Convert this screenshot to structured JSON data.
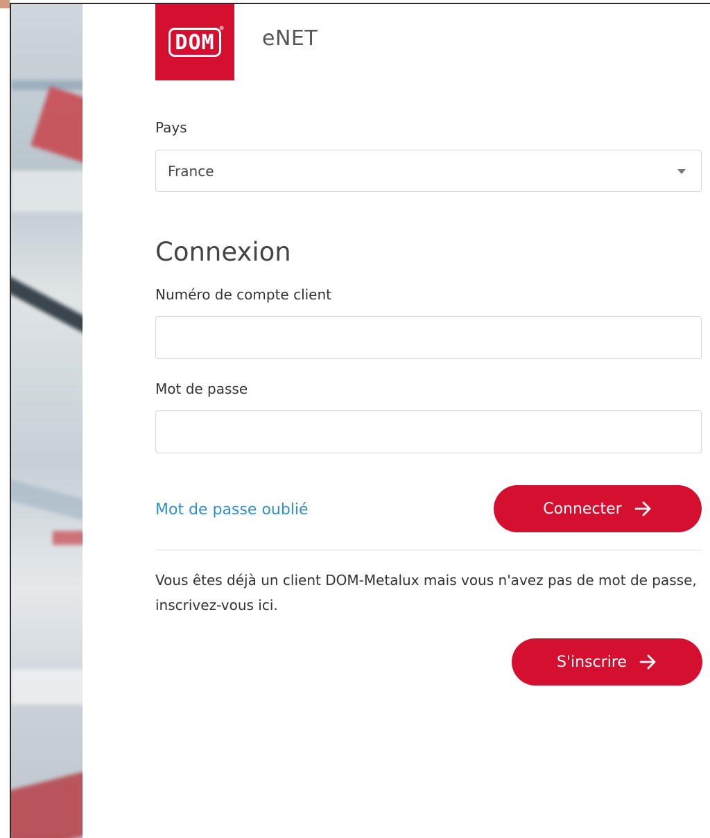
{
  "brand": {
    "logo_text": "DOM",
    "logo_reg": "®",
    "app_name": "eNET",
    "accent_color": "#d50f2f",
    "link_color": "#2f8fcd"
  },
  "country": {
    "label": "Pays",
    "selected": "France"
  },
  "login": {
    "title": "Connexion",
    "account_label": "Numéro de compte client",
    "account_value": "",
    "password_label": "Mot de passe",
    "password_value": "",
    "forgot_link": "Mot de passe oublié",
    "connect_label": "Connecter"
  },
  "register": {
    "info": "Vous êtes déjà un client DOM-Metalux mais vous n'avez pas de mot de passe, inscrivez-vous ici.",
    "button_label": "S'inscrire"
  },
  "icons": {
    "arrow": "arrow-right-icon",
    "dropdown": "caret-down-icon"
  }
}
